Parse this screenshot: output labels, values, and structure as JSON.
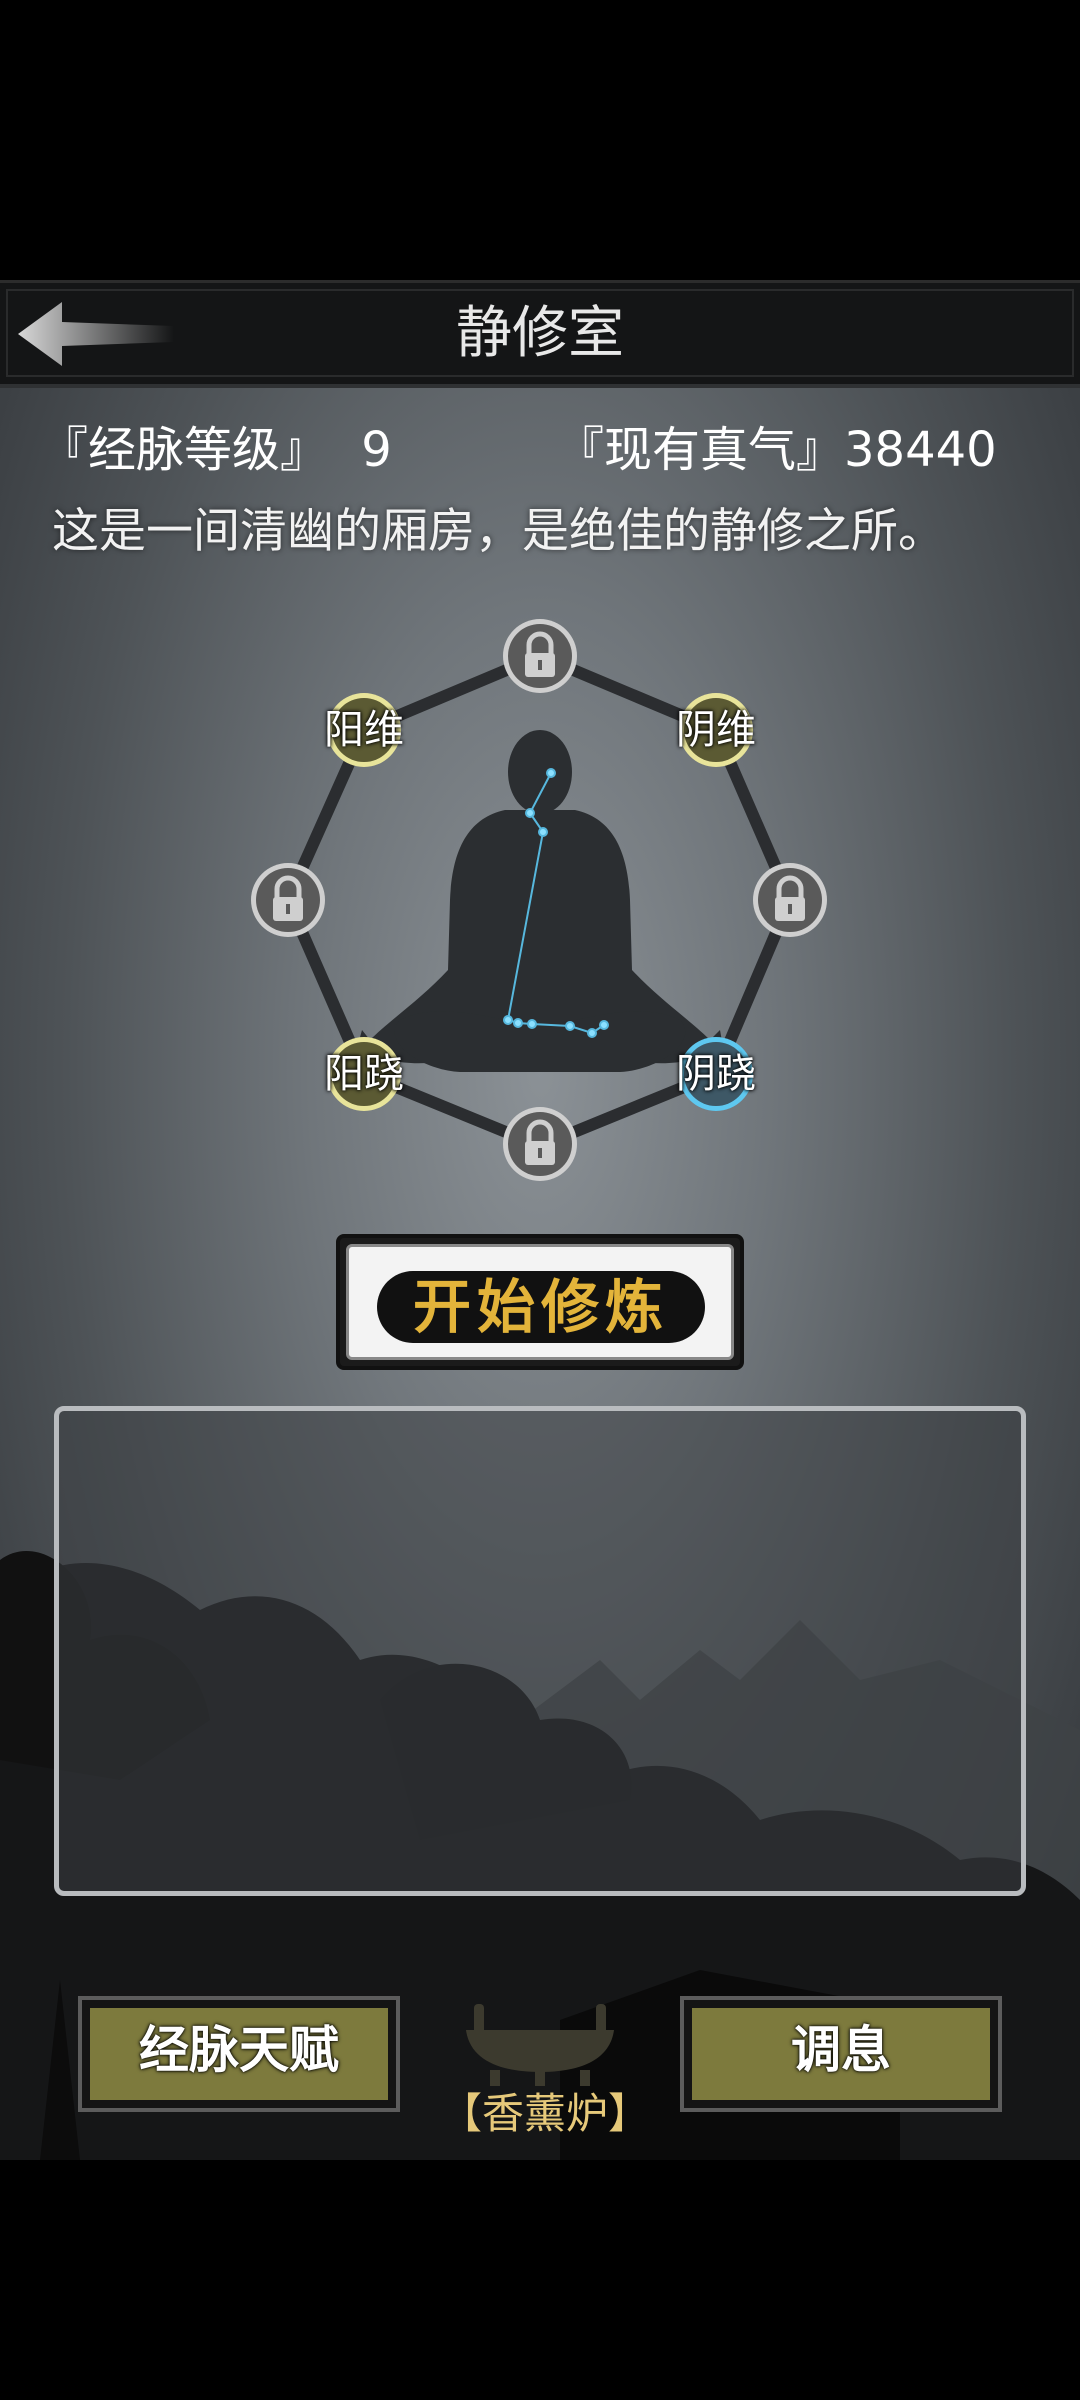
{
  "header": {
    "title": "静修室",
    "back_icon": "back-arrow-icon"
  },
  "stats": {
    "meridian_level_label": "『经脉等级』",
    "meridian_level_value": "9",
    "qi_label": "『现有真气』",
    "qi_value": "38440"
  },
  "description": "这是一间清幽的厢房，是绝佳的静修之所。",
  "meridian_nodes": [
    {
      "label": "阳维",
      "state": "unlocked",
      "ring_color": "#e8e49a"
    },
    {
      "label": "阴维",
      "state": "unlocked",
      "ring_color": "#e8e49a"
    },
    {
      "label": "阳跷",
      "state": "unlocked",
      "ring_color": "#e8e49a"
    },
    {
      "label": "阴跷",
      "state": "active",
      "ring_color": "#5ec8f0"
    }
  ],
  "locked_node_icon": "lock-icon",
  "start_button": "开始修炼",
  "bottom": {
    "left_button": "经脉天赋",
    "right_button": "调息",
    "incense_label": "【香薰炉】",
    "incense_icon": "incense-burner-icon"
  },
  "colors": {
    "button_olive": "#7d7a3d",
    "start_text": "#e3b43a",
    "active_node": "#5ec8f0"
  }
}
